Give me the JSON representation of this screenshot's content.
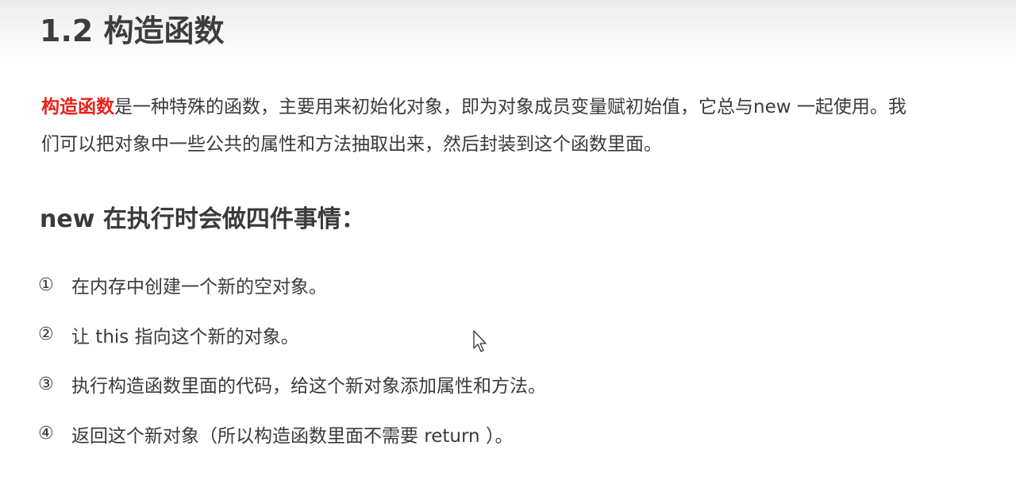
{
  "page": {
    "title": "1.2 构造函数"
  },
  "intro": {
    "highlight": "构造函数",
    "line1_rest": "是一种特殊的函数，主要用来初始化对象，即为对象成员变量赋初始值，它总与new 一起使用。我",
    "line2": "们可以把对象中一些公共的属性和方法抽取出来，然后封装到这个函数里面。"
  },
  "section": {
    "heading": "new 在执行时会做四件事情："
  },
  "steps": [
    {
      "num": "①",
      "text": "在内存中创建一个新的空对象。"
    },
    {
      "num": "②",
      "text": "让 this 指向这个新的对象。"
    },
    {
      "num": "③",
      "text": "执行构造函数里面的代码，给这个新对象添加属性和方法。"
    },
    {
      "num": "④",
      "text": "返回这个新对象（所以构造函数里面不需要 return ）。"
    }
  ],
  "icons": {
    "cursor": "mouse-pointer-icon"
  }
}
